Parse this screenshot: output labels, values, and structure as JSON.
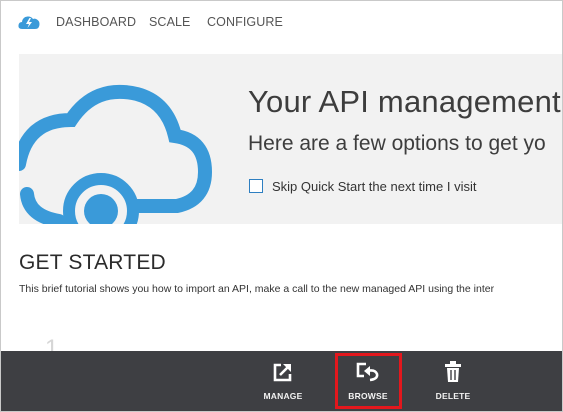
{
  "nav": {
    "items": [
      {
        "label": "DASHBOARD"
      },
      {
        "label": "SCALE"
      },
      {
        "label": "CONFIGURE"
      }
    ]
  },
  "hero": {
    "title": "Your API management s",
    "subtitle": "Here are a few options to get yo",
    "skip_label": "Skip Quick Start the next time I visit",
    "skip_checked": false
  },
  "get_started": {
    "title": "GET STARTED",
    "description": "This brief tutorial shows you how to import an API, make a call to the new managed API using the inter",
    "step_number": "1"
  },
  "commands": {
    "manage": "MANAGE",
    "browse": "BROWSE",
    "delete": "DELETE"
  },
  "colors": {
    "accent": "#3a9ad9",
    "command_bar": "#3e3f43",
    "highlight": "#e3171d",
    "hero_bg": "#f2f2f2"
  }
}
